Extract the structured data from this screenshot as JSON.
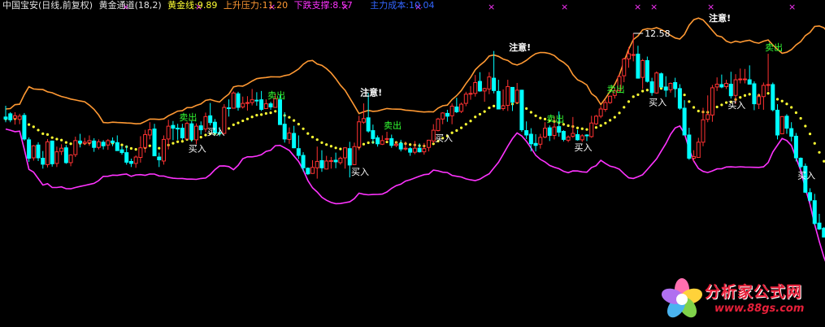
{
  "header": {
    "title": "中国宝安(日线,前复权)",
    "channel": "黄金通道(18,2)",
    "gold_line": "黄金线:9.89",
    "upper": "上升压力:11.20",
    "lower": "下跌支撑:8.57",
    "cost": "主力成本:10.04"
  },
  "colors": {
    "background": "#000000",
    "up_candle": "#ff3232",
    "down_candle": "#00ffff",
    "upper_band": "#ff9933",
    "lower_band": "#ff33ff",
    "gold_dots": "#ffff33",
    "buy_text": "#ffffff",
    "sell_text": "#33ff33",
    "x_marker": "#ff33ff"
  },
  "watermark": {
    "line1": "分析家公式网",
    "line2": "www.88gs.com"
  },
  "chart_data": {
    "type": "candlestick",
    "labels": {
      "buy": "买入",
      "sell": "卖出",
      "note": "注意!"
    },
    "max_label": "12.58",
    "buy_at": [
      40,
      44,
      75,
      93,
      123,
      139,
      156,
      171
    ],
    "sell_at": [
      38,
      57,
      82,
      117,
      130,
      164
    ],
    "note_at": [
      78,
      110,
      153,
      183
    ],
    "candles": [
      {
        "o": 10.49,
        "h": 10.77,
        "l": 10.36,
        "c": 10.44
      },
      {
        "o": 10.57,
        "h": 10.61,
        "l": 10.36,
        "c": 10.42
      },
      {
        "o": 10.46,
        "h": 10.61,
        "l": 10.3,
        "c": 10.52
      },
      {
        "o": 10.43,
        "h": 10.57,
        "l": 10.31,
        "c": 10.51
      },
      {
        "o": 10.53,
        "h": 10.59,
        "l": 9.9,
        "c": 9.94
      },
      {
        "o": 9.92,
        "h": 9.98,
        "l": 9.37,
        "c": 9.46
      },
      {
        "o": 9.47,
        "h": 9.79,
        "l": 9.4,
        "c": 9.77
      },
      {
        "o": 9.79,
        "h": 9.86,
        "l": 9.39,
        "c": 9.47
      },
      {
        "o": 9.46,
        "h": 9.64,
        "l": 9.2,
        "c": 9.31
      },
      {
        "o": 9.3,
        "h": 9.94,
        "l": 9.23,
        "c": 9.87
      },
      {
        "o": 9.89,
        "h": 9.9,
        "l": 9.25,
        "c": 9.32
      },
      {
        "o": 9.33,
        "h": 9.75,
        "l": 9.24,
        "c": 9.62
      },
      {
        "o": 9.63,
        "h": 9.81,
        "l": 9.54,
        "c": 9.71
      },
      {
        "o": 9.72,
        "h": 9.79,
        "l": 9.32,
        "c": 9.35
      },
      {
        "o": 9.35,
        "h": 9.56,
        "l": 9.26,
        "c": 9.54
      },
      {
        "o": 9.55,
        "h": 10.0,
        "l": 9.49,
        "c": 9.9
      },
      {
        "o": 9.89,
        "h": 10.07,
        "l": 9.73,
        "c": 9.84
      },
      {
        "o": 9.83,
        "h": 9.97,
        "l": 9.79,
        "c": 9.86
      },
      {
        "o": 9.85,
        "h": 10.03,
        "l": 9.77,
        "c": 9.9
      },
      {
        "o": 9.89,
        "h": 9.96,
        "l": 9.62,
        "c": 9.73
      },
      {
        "o": 9.73,
        "h": 9.93,
        "l": 9.68,
        "c": 9.87
      },
      {
        "o": 9.86,
        "h": 9.91,
        "l": 9.68,
        "c": 9.77
      },
      {
        "o": 9.79,
        "h": 9.94,
        "l": 9.67,
        "c": 9.9
      },
      {
        "o": 9.89,
        "h": 9.98,
        "l": 9.76,
        "c": 9.85
      },
      {
        "o": 9.85,
        "h": 10.03,
        "l": 9.65,
        "c": 9.65
      },
      {
        "o": 9.67,
        "h": 9.76,
        "l": 9.55,
        "c": 9.6
      },
      {
        "o": 9.6,
        "h": 9.78,
        "l": 9.3,
        "c": 9.36
      },
      {
        "o": 9.38,
        "h": 9.45,
        "l": 9.24,
        "c": 9.33
      },
      {
        "o": 9.33,
        "h": 9.53,
        "l": 9.22,
        "c": 9.49
      },
      {
        "o": 9.48,
        "h": 10.01,
        "l": 9.35,
        "c": 9.72
      },
      {
        "o": 9.73,
        "h": 10.17,
        "l": 9.6,
        "c": 10.05
      },
      {
        "o": 10.04,
        "h": 10.36,
        "l": 9.93,
        "c": 10.17
      },
      {
        "o": 10.19,
        "h": 10.32,
        "l": 9.52,
        "c": 9.52
      },
      {
        "o": 9.49,
        "h": 9.6,
        "l": 9.24,
        "c": 9.42
      },
      {
        "o": 9.39,
        "h": 10.03,
        "l": 9.3,
        "c": 9.93
      },
      {
        "o": 9.94,
        "h": 10.42,
        "l": 9.68,
        "c": 10.26
      },
      {
        "o": 10.28,
        "h": 10.39,
        "l": 9.91,
        "c": 10.21
      },
      {
        "o": 10.21,
        "h": 10.32,
        "l": 9.92,
        "c": 10.2
      },
      {
        "o": 10.21,
        "h": 10.32,
        "l": 9.92,
        "c": 9.97
      },
      {
        "o": 9.94,
        "h": 10.37,
        "l": 9.93,
        "c": 10.33
      },
      {
        "o": 10.32,
        "h": 10.39,
        "l": 9.87,
        "c": 9.93
      },
      {
        "o": 9.92,
        "h": 10.33,
        "l": 9.81,
        "c": 10.26
      },
      {
        "o": 10.27,
        "h": 10.38,
        "l": 10.05,
        "c": 10.17
      },
      {
        "o": 10.19,
        "h": 10.6,
        "l": 10.11,
        "c": 10.5
      },
      {
        "o": 10.52,
        "h": 10.84,
        "l": 10.28,
        "c": 10.35
      },
      {
        "o": 10.36,
        "h": 10.44,
        "l": 10.04,
        "c": 10.09
      },
      {
        "o": 10.1,
        "h": 10.24,
        "l": 10.01,
        "c": 10.08
      },
      {
        "o": 10.08,
        "h": 10.81,
        "l": 10.06,
        "c": 10.73
      },
      {
        "o": 10.72,
        "h": 10.93,
        "l": 10.5,
        "c": 10.71
      },
      {
        "o": 10.71,
        "h": 11.13,
        "l": 10.71,
        "c": 11.09
      },
      {
        "o": 11.07,
        "h": 11.12,
        "l": 10.65,
        "c": 10.73
      },
      {
        "o": 10.74,
        "h": 11.0,
        "l": 10.7,
        "c": 10.83
      },
      {
        "o": 10.83,
        "h": 11.01,
        "l": 10.65,
        "c": 10.85
      },
      {
        "o": 10.85,
        "h": 11.19,
        "l": 10.78,
        "c": 10.92
      },
      {
        "o": 10.91,
        "h": 11.11,
        "l": 10.77,
        "c": 10.9
      },
      {
        "o": 10.92,
        "h": 11.14,
        "l": 10.64,
        "c": 10.68
      },
      {
        "o": 10.7,
        "h": 10.93,
        "l": 10.69,
        "c": 10.82
      },
      {
        "o": 10.82,
        "h": 10.87,
        "l": 10.67,
        "c": 10.74
      },
      {
        "o": 10.73,
        "h": 11.07,
        "l": 10.73,
        "c": 10.95
      },
      {
        "o": 10.92,
        "h": 11.03,
        "l": 10.31,
        "c": 10.3
      },
      {
        "o": 10.31,
        "h": 10.61,
        "l": 9.85,
        "c": 9.94
      },
      {
        "o": 9.93,
        "h": 10.23,
        "l": 9.82,
        "c": 10.09
      },
      {
        "o": 10.08,
        "h": 10.27,
        "l": 9.71,
        "c": 9.72
      },
      {
        "o": 9.7,
        "h": 10.03,
        "l": 9.44,
        "c": 9.53
      },
      {
        "o": 9.53,
        "h": 9.61,
        "l": 9.13,
        "c": 9.22
      },
      {
        "o": 9.21,
        "h": 9.23,
        "l": 9.04,
        "c": 9.07
      },
      {
        "o": 9.08,
        "h": 9.41,
        "l": 9.07,
        "c": 9.23
      },
      {
        "o": 9.22,
        "h": 9.75,
        "l": 8.95,
        "c": 9.38
      },
      {
        "o": 9.4,
        "h": 9.66,
        "l": 9.12,
        "c": 9.22
      },
      {
        "o": 9.19,
        "h": 9.52,
        "l": 9.18,
        "c": 9.39
      },
      {
        "o": 9.38,
        "h": 9.49,
        "l": 9.2,
        "c": 9.4
      },
      {
        "o": 9.41,
        "h": 9.6,
        "l": 9.21,
        "c": 9.37
      },
      {
        "o": 9.35,
        "h": 9.5,
        "l": 9.3,
        "c": 9.46
      },
      {
        "o": 9.47,
        "h": 9.73,
        "l": 9.2,
        "c": 9.72
      },
      {
        "o": 9.7,
        "h": 9.87,
        "l": 8.98,
        "c": 9.29
      },
      {
        "o": 9.3,
        "h": 9.85,
        "l": 9.29,
        "c": 9.75
      },
      {
        "o": 9.74,
        "h": 10.52,
        "l": 9.66,
        "c": 10.37
      },
      {
        "o": 10.36,
        "h": 10.83,
        "l": 10.32,
        "c": 10.45
      },
      {
        "o": 10.47,
        "h": 11.09,
        "l": 10.1,
        "c": 10.14
      },
      {
        "o": 10.15,
        "h": 10.3,
        "l": 9.82,
        "c": 9.95
      },
      {
        "o": 9.97,
        "h": 10.03,
        "l": 9.75,
        "c": 9.82
      },
      {
        "o": 9.81,
        "h": 10.03,
        "l": 9.79,
        "c": 9.9
      },
      {
        "o": 9.93,
        "h": 10.12,
        "l": 9.88,
        "c": 9.95
      },
      {
        "o": 9.95,
        "h": 10.05,
        "l": 9.72,
        "c": 9.78
      },
      {
        "o": 9.78,
        "h": 9.87,
        "l": 9.74,
        "c": 9.81
      },
      {
        "o": 9.83,
        "h": 9.92,
        "l": 9.63,
        "c": 9.69
      },
      {
        "o": 9.7,
        "h": 9.88,
        "l": 9.65,
        "c": 9.71
      },
      {
        "o": 9.7,
        "h": 9.74,
        "l": 9.52,
        "c": 9.61
      },
      {
        "o": 9.61,
        "h": 9.89,
        "l": 9.56,
        "c": 9.71
      },
      {
        "o": 9.71,
        "h": 9.83,
        "l": 9.6,
        "c": 9.62
      },
      {
        "o": 9.62,
        "h": 9.84,
        "l": 9.55,
        "c": 9.7
      },
      {
        "o": 9.73,
        "h": 9.92,
        "l": 9.63,
        "c": 9.91
      },
      {
        "o": 9.89,
        "h": 10.31,
        "l": 9.83,
        "c": 10.16
      },
      {
        "o": 10.15,
        "h": 10.47,
        "l": 10.13,
        "c": 10.44
      },
      {
        "o": 10.44,
        "h": 10.61,
        "l": 10.31,
        "c": 10.59
      },
      {
        "o": 10.58,
        "h": 10.67,
        "l": 10.37,
        "c": 10.51
      },
      {
        "o": 10.52,
        "h": 10.83,
        "l": 10.31,
        "c": 10.76
      },
      {
        "o": 10.74,
        "h": 10.97,
        "l": 10.59,
        "c": 10.62
      },
      {
        "o": 10.63,
        "h": 10.85,
        "l": 10.59,
        "c": 10.81
      },
      {
        "o": 10.83,
        "h": 11.12,
        "l": 10.76,
        "c": 11.06
      },
      {
        "o": 11.06,
        "h": 11.26,
        "l": 10.92,
        "c": 11.08
      },
      {
        "o": 11.08,
        "h": 11.54,
        "l": 11.0,
        "c": 11.35
      },
      {
        "o": 11.38,
        "h": 11.61,
        "l": 11.12,
        "c": 11.14
      },
      {
        "o": 11.14,
        "h": 11.22,
        "l": 10.87,
        "c": 11.2
      },
      {
        "o": 11.19,
        "h": 11.61,
        "l": 11.06,
        "c": 11.49
      },
      {
        "o": 11.46,
        "h": 12.14,
        "l": 11.08,
        "c": 11.15
      },
      {
        "o": 11.13,
        "h": 11.42,
        "l": 10.68,
        "c": 10.69
      },
      {
        "o": 10.7,
        "h": 11.18,
        "l": 10.65,
        "c": 10.77
      },
      {
        "o": 10.78,
        "h": 11.42,
        "l": 10.64,
        "c": 11.25
      },
      {
        "o": 11.23,
        "h": 11.23,
        "l": 10.64,
        "c": 10.86
      },
      {
        "o": 10.85,
        "h": 11.34,
        "l": 10.84,
        "c": 11.16
      },
      {
        "o": 11.16,
        "h": 11.17,
        "l": 10.12,
        "c": 10.17
      },
      {
        "o": 10.15,
        "h": 10.38,
        "l": 9.94,
        "c": 10.04
      },
      {
        "o": 10.06,
        "h": 10.21,
        "l": 9.63,
        "c": 9.82
      },
      {
        "o": 9.83,
        "h": 10.06,
        "l": 9.63,
        "c": 9.78
      },
      {
        "o": 9.81,
        "h": 10.07,
        "l": 9.7,
        "c": 9.98
      },
      {
        "o": 9.99,
        "h": 10.36,
        "l": 9.96,
        "c": 10.21
      },
      {
        "o": 10.22,
        "h": 10.28,
        "l": 9.89,
        "c": 10.03
      },
      {
        "o": 10.03,
        "h": 10.51,
        "l": 9.93,
        "c": 10.24
      },
      {
        "o": 10.25,
        "h": 10.63,
        "l": 10.0,
        "c": 10.11
      },
      {
        "o": 10.13,
        "h": 10.16,
        "l": 9.88,
        "c": 9.93
      },
      {
        "o": 9.91,
        "h": 10.03,
        "l": 9.86,
        "c": 9.99
      },
      {
        "o": 10.01,
        "h": 10.49,
        "l": 9.97,
        "c": 10.08
      },
      {
        "o": 10.05,
        "h": 10.17,
        "l": 9.9,
        "c": 9.92
      },
      {
        "o": 9.92,
        "h": 10.06,
        "l": 9.87,
        "c": 10.02
      },
      {
        "o": 10.04,
        "h": 10.06,
        "l": 9.89,
        "c": 10.02
      },
      {
        "o": 10.0,
        "h": 10.52,
        "l": 9.97,
        "c": 10.34
      },
      {
        "o": 10.32,
        "h": 10.54,
        "l": 10.29,
        "c": 10.51
      },
      {
        "o": 10.51,
        "h": 10.76,
        "l": 10.46,
        "c": 10.69
      },
      {
        "o": 10.68,
        "h": 10.92,
        "l": 10.62,
        "c": 10.85
      },
      {
        "o": 10.85,
        "h": 11.02,
        "l": 10.82,
        "c": 11.01
      },
      {
        "o": 11.03,
        "h": 11.21,
        "l": 10.95,
        "c": 11.14
      },
      {
        "o": 11.15,
        "h": 11.56,
        "l": 11.13,
        "c": 11.5
      },
      {
        "o": 11.52,
        "h": 11.97,
        "l": 11.36,
        "c": 11.94
      },
      {
        "o": 11.94,
        "h": 12.24,
        "l": 11.72,
        "c": 12.07
      },
      {
        "o": 12.04,
        "h": 12.58,
        "l": 11.88,
        "c": 12.05
      },
      {
        "o": 12.06,
        "h": 12.27,
        "l": 11.45,
        "c": 11.46
      },
      {
        "o": 11.48,
        "h": 11.94,
        "l": 11.19,
        "c": 11.9
      },
      {
        "o": 11.9,
        "h": 12.0,
        "l": 11.35,
        "c": 11.38
      },
      {
        "o": 11.37,
        "h": 11.47,
        "l": 11.02,
        "c": 11.1
      },
      {
        "o": 11.09,
        "h": 11.63,
        "l": 11.07,
        "c": 11.59
      },
      {
        "o": 11.57,
        "h": 11.6,
        "l": 11.21,
        "c": 11.24
      },
      {
        "o": 11.24,
        "h": 11.51,
        "l": 10.99,
        "c": 11.16
      },
      {
        "o": 11.17,
        "h": 11.35,
        "l": 11.1,
        "c": 11.33
      },
      {
        "o": 11.35,
        "h": 11.47,
        "l": 10.98,
        "c": 11.2
      },
      {
        "o": 11.2,
        "h": 11.31,
        "l": 10.67,
        "c": 10.71
      },
      {
        "o": 10.71,
        "h": 10.91,
        "l": 10.03,
        "c": 10.04
      },
      {
        "o": 10.04,
        "h": 10.22,
        "l": 9.42,
        "c": 9.46
      },
      {
        "o": 9.46,
        "h": 9.66,
        "l": 9.39,
        "c": 9.5
      },
      {
        "o": 9.48,
        "h": 9.97,
        "l": 9.47,
        "c": 9.86
      },
      {
        "o": 9.86,
        "h": 10.72,
        "l": 9.76,
        "c": 10.42
      },
      {
        "o": 10.43,
        "h": 11.03,
        "l": 10.36,
        "c": 10.55
      },
      {
        "o": 10.54,
        "h": 11.29,
        "l": 10.37,
        "c": 11.22
      },
      {
        "o": 11.24,
        "h": 11.48,
        "l": 11.14,
        "c": 11.31
      },
      {
        "o": 11.3,
        "h": 11.55,
        "l": 11.21,
        "c": 11.24
      },
      {
        "o": 11.25,
        "h": 11.42,
        "l": 11.19,
        "c": 11.33
      },
      {
        "o": 11.31,
        "h": 11.62,
        "l": 10.95,
        "c": 11.02
      },
      {
        "o": 11.03,
        "h": 11.56,
        "l": 10.82,
        "c": 11.42
      },
      {
        "o": 11.42,
        "h": 11.7,
        "l": 11.33,
        "c": 11.44
      },
      {
        "o": 11.43,
        "h": 11.69,
        "l": 11.33,
        "c": 11.44
      },
      {
        "o": 11.42,
        "h": 11.78,
        "l": 11.3,
        "c": 11.31
      },
      {
        "o": 11.32,
        "h": 11.38,
        "l": 10.66,
        "c": 10.82
      },
      {
        "o": 10.81,
        "h": 11.08,
        "l": 10.69,
        "c": 11.0
      },
      {
        "o": 11.0,
        "h": 11.35,
        "l": 10.67,
        "c": 11.28
      },
      {
        "o": 11.29,
        "h": 12.07,
        "l": 11.13,
        "c": 11.3
      },
      {
        "o": 11.3,
        "h": 11.35,
        "l": 10.63,
        "c": 10.67
      },
      {
        "o": 10.66,
        "h": 10.81,
        "l": 9.93,
        "c": 10.04
      },
      {
        "o": 10.07,
        "h": 10.51,
        "l": 10.06,
        "c": 10.5
      },
      {
        "o": 10.51,
        "h": 10.56,
        "l": 10.07,
        "c": 10.21
      },
      {
        "o": 10.2,
        "h": 10.36,
        "l": 9.88,
        "c": 10.01
      },
      {
        "o": 10.01,
        "h": 10.09,
        "l": 9.38,
        "c": 9.47
      },
      {
        "o": 9.46,
        "h": 9.48,
        "l": 9.2,
        "c": 9.25
      },
      {
        "o": 9.26,
        "h": 9.33,
        "l": 8.59,
        "c": 8.61
      },
      {
        "o": 8.6,
        "h": 8.71,
        "l": 8.36,
        "c": 8.41
      },
      {
        "o": 8.4,
        "h": 8.57,
        "l": 7.79,
        "c": 7.83
      },
      {
        "o": 7.84,
        "h": 8.07,
        "l": 7.67,
        "c": 7.69
      },
      {
        "o": 7.71,
        "h": 7.74,
        "l": 7.48,
        "c": 7.49
      },
      {
        "o": 7.5,
        "h": 7.65,
        "l": 7.46,
        "c": 7.51
      },
      {
        "o": 7.49,
        "h": 7.72,
        "l": 7.17,
        "c": 7.25
      },
      {
        "o": 7.24,
        "h": 7.36,
        "l": 6.73,
        "c": 6.74
      },
      {
        "o": 6.73,
        "h": 6.92,
        "l": 6.62,
        "c": 6.67
      },
      {
        "o": 6.65,
        "h": 6.95,
        "l": 6.31,
        "c": 6.45
      },
      {
        "o": 6.47,
        "h": 6.62,
        "l": 6.39,
        "c": 6.54
      },
      {
        "o": 6.55,
        "h": 7.35,
        "l": 6.47,
        "c": 7.18
      },
      {
        "o": 7.17,
        "h": 7.71,
        "l": 7.1,
        "c": 7.67
      },
      {
        "o": 7.66,
        "h": 7.88,
        "l": 7.56,
        "c": 7.85
      },
      {
        "o": 7.85,
        "h": 8.16,
        "l": 7.75,
        "c": 7.88
      },
      {
        "o": 7.88,
        "h": 8.11,
        "l": 7.87,
        "c": 8.07
      },
      {
        "o": 8.05,
        "h": 8.31,
        "l": 7.99,
        "c": 8.27
      },
      {
        "o": 8.25,
        "h": 8.45,
        "l": 8.06,
        "c": 8.29
      }
    ]
  }
}
